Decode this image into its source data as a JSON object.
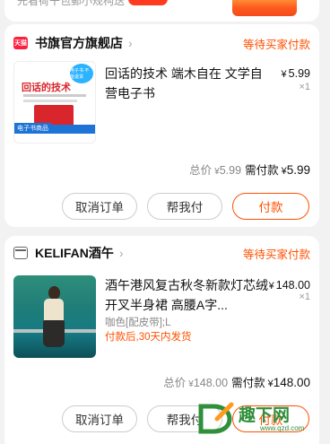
{
  "top_strip": {
    "partial_text": "先看荷干包郵小规构送"
  },
  "orders": [
    {
      "shop_icon": "tmall-icon",
      "shop_icon_text": "天猫",
      "shop_name": "书旗官方旗舰店",
      "status": "等待买家付款",
      "title": "回话的技术 端木自在 文学自营电子书",
      "unit_price": "5.99",
      "quantity": "×1",
      "thumbnail": {
        "title": "回话的技术",
        "badge": "电子书 不能退货",
        "tag": "电子书商品"
      },
      "total_label": "总价",
      "total_value": "5.99",
      "due_label": "需付款",
      "due_value": "5.99",
      "buttons": [
        "取消订单",
        "帮我付",
        "付款"
      ]
    },
    {
      "shop_icon": "store-icon",
      "shop_name": "KELIFAN酒午",
      "status": "等待买家付款",
      "title": "酒午港风复古秋冬新款灯芯绒开叉半身裙 高腰A字...",
      "unit_price": "148.00",
      "quantity": "×1",
      "sku": "咖色[配皮带];L",
      "shipping": "付款后,30天内发货",
      "total_label": "总价",
      "total_value": "148.00",
      "due_label": "需付款",
      "due_value": "148.00",
      "buttons": [
        "取消订单",
        "帮我付",
        "付款"
      ]
    }
  ],
  "currency": "¥",
  "watermark": {
    "text": "趣下网",
    "url": "www.qzd.com"
  }
}
